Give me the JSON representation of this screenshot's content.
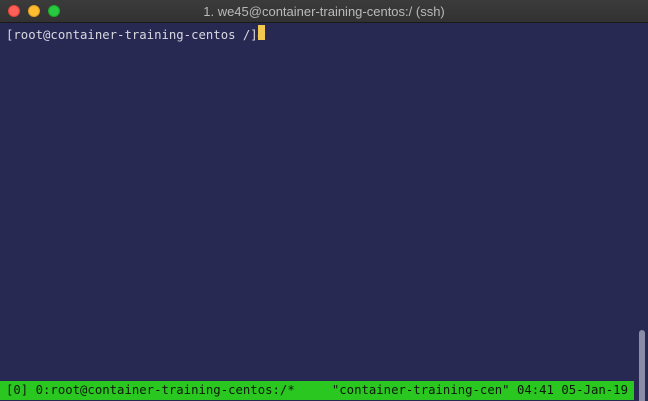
{
  "window": {
    "title": "1. we45@container-training-centos:/ (ssh)"
  },
  "terminal": {
    "prompt": "[root@container-training-centos /]# ",
    "cursor_color": "#f3c84f",
    "background_color": "#272952"
  },
  "statusbar": {
    "left": "[0] 0:root@container-training-centos:/*",
    "right": "\"container-training-cen\" 04:41 05-Jan-19",
    "color": "#29c720"
  },
  "icons": {
    "close": "close-traffic-light-icon",
    "minimize": "minimize-traffic-light-icon",
    "maximize": "maximize-traffic-light-icon"
  }
}
